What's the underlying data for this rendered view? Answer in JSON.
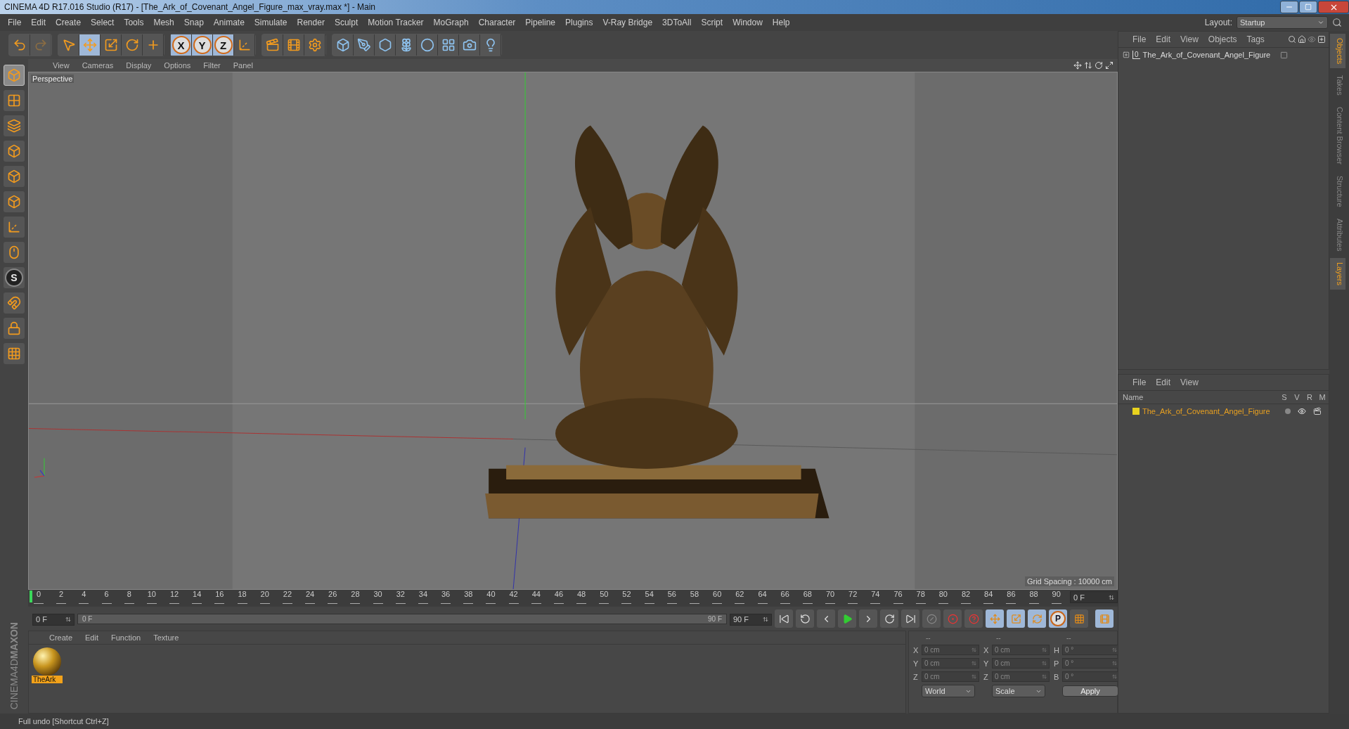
{
  "window": {
    "title": "CINEMA 4D R17.016 Studio (R17) - [The_Ark_of_Covenant_Angel_Figure_max_vray.max *] - Main"
  },
  "menu": [
    "File",
    "Edit",
    "Create",
    "Select",
    "Tools",
    "Mesh",
    "Snap",
    "Animate",
    "Simulate",
    "Render",
    "Sculpt",
    "Motion Tracker",
    "MoGraph",
    "Character",
    "Pipeline",
    "Plugins",
    "V-Ray Bridge",
    "3DToAll",
    "Script",
    "Window",
    "Help"
  ],
  "layout": {
    "label": "Layout:",
    "value": "Startup"
  },
  "toolbar": {
    "groups": [
      [
        {
          "selected": false,
          "disabled": false
        },
        {
          "selected": false,
          "disabled": true
        }
      ],
      [
        {
          "selected": false,
          "disabled": false
        },
        {
          "selected": true,
          "disabled": false
        },
        {
          "selected": false,
          "disabled": false
        },
        {
          "selected": false,
          "disabled": false
        },
        {
          "selected": false,
          "disabled": false
        }
      ],
      [
        {
          "label": "X",
          "selected": true,
          "disabled": false
        },
        {
          "label": "Y",
          "selected": true,
          "disabled": false
        },
        {
          "label": "Z",
          "selected": true,
          "disabled": false
        },
        {
          "selected": false,
          "disabled": false
        }
      ],
      [
        {
          "selected": false,
          "disabled": false
        },
        {
          "selected": false,
          "disabled": false
        },
        {
          "selected": false,
          "disabled": false
        }
      ],
      [
        {
          "selected": false,
          "disabled": false
        },
        {
          "selected": false,
          "disabled": false
        },
        {
          "selected": false,
          "disabled": false
        },
        {
          "selected": false,
          "disabled": false
        },
        {
          "selected": false,
          "disabled": false
        },
        {
          "selected": false,
          "disabled": false
        },
        {
          "selected": false,
          "disabled": false
        },
        {
          "selected": false,
          "disabled": false
        }
      ]
    ]
  },
  "left_toolbar": [
    {
      "selected": true
    },
    {
      "selected": false
    },
    {
      "selected": false
    },
    {
      "selected": false
    },
    {
      "selected": false
    },
    {
      "selected": false
    },
    {
      "selected": false
    },
    {
      "selected": false
    },
    {
      "label": "S",
      "selected": false
    },
    {
      "selected": false
    },
    {
      "selected": false
    },
    {
      "selected": false
    }
  ],
  "viewport": {
    "menu": [
      "View",
      "Cameras",
      "Display",
      "Options",
      "Filter",
      "Panel"
    ],
    "camera": "Perspective",
    "grid_spacing": "Grid Spacing : 10000 cm"
  },
  "timeline": {
    "labels": [
      "0",
      "2",
      "4",
      "6",
      "8",
      "10",
      "12",
      "14",
      "16",
      "18",
      "20",
      "22",
      "24",
      "26",
      "28",
      "30",
      "32",
      "34",
      "36",
      "38",
      "40",
      "42",
      "44",
      "46",
      "48",
      "50",
      "52",
      "54",
      "56",
      "58",
      "60",
      "62",
      "64",
      "66",
      "68",
      "70",
      "72",
      "74",
      "76",
      "78",
      "80",
      "82",
      "84",
      "86",
      "88",
      "90"
    ],
    "current_frame": "0 F"
  },
  "transport": {
    "start": "0 F",
    "range": {
      "start": "0 F",
      "end": "90 F",
      "level": 1
    },
    "end": "90 F",
    "p_label": "P"
  },
  "materials": {
    "menu": [
      "Create",
      "Edit",
      "Function",
      "Texture"
    ],
    "items": [
      {
        "name": "TheArk",
        "selected": true
      }
    ]
  },
  "coordinates": {
    "headers": [
      "--",
      "--",
      "--"
    ],
    "rows": [
      {
        "a": "X",
        "a_value": "0 cm",
        "b": "X",
        "b_value": "0 cm",
        "c": "H",
        "c_value": "0 °"
      },
      {
        "a": "Y",
        "a_value": "0 cm",
        "b": "Y",
        "b_value": "0 cm",
        "c": "P",
        "c_value": "0 °"
      },
      {
        "a": "Z",
        "a_value": "0 cm",
        "b": "Z",
        "b_value": "0 cm",
        "c": "B",
        "c_value": "0 °"
      }
    ],
    "space": "World",
    "mode": "Scale",
    "apply": "Apply"
  },
  "objects": {
    "menu": [
      "File",
      "Edit",
      "View",
      "Objects",
      "Tags"
    ],
    "items": [
      {
        "name": "The_Ark_of_Covenant_Angel_Figure",
        "layer_badge": "0"
      }
    ]
  },
  "layers": {
    "menu": [
      "File",
      "Edit",
      "View"
    ],
    "columns": [
      "Name",
      "S",
      "V",
      "R",
      "M"
    ],
    "items": [
      {
        "name": "The_Ark_of_Covenant_Angel_Figure",
        "color": "#e8d21e"
      }
    ]
  },
  "side_tabs": [
    {
      "label": "Objects",
      "selected": true
    },
    {
      "label": "Takes",
      "selected": false
    },
    {
      "label": "Content Browser",
      "selected": false
    },
    {
      "label": "Structure",
      "selected": false
    },
    {
      "label": "Attributes",
      "selected": false
    },
    {
      "label": "Layers",
      "selected": true
    }
  ],
  "brand": {
    "top": "MAXON",
    "bottom": "CINEMA4D"
  },
  "status": "Full undo [Shortcut Ctrl+Z]"
}
